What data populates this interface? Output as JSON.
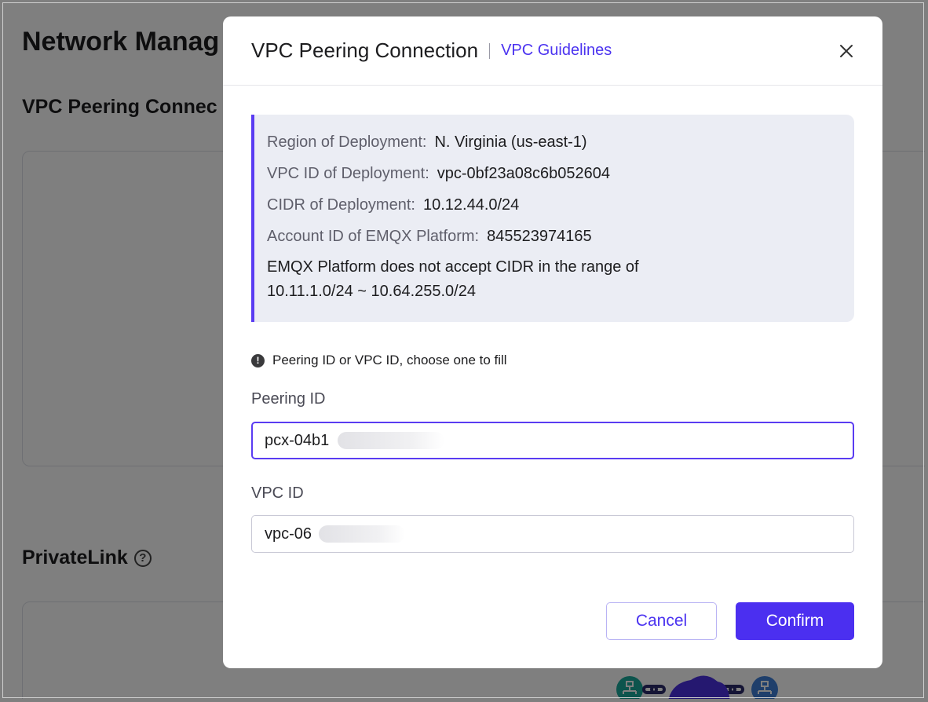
{
  "background": {
    "page_title": "Network Manag",
    "vpc_section_title": "VPC Peering Connec",
    "privatelink_title": "PrivateLink",
    "help_icon": "question-circle-icon"
  },
  "dialog": {
    "title": "VPC Peering Connection",
    "guide_link": "VPC Guidelines",
    "close_icon": "close-icon",
    "info": {
      "region_label": "Region of Deployment:",
      "region_value": "N. Virginia (us-east-1)",
      "vpc_id_label": "VPC ID of Deployment:",
      "vpc_id_value": "vpc-0bf23a08c6b052604",
      "cidr_label": "CIDR of Deployment:",
      "cidr_value": "10.12.44.0/24",
      "account_label": "Account ID of EMQX Platform:",
      "account_value": "845523974165",
      "note_line1": "EMQX Platform does not accept CIDR in the range of",
      "note_line2": "10.11.1.0/24 ~ 10.64.255.0/24"
    },
    "hint": "Peering ID or VPC ID, choose one to fill",
    "hint_icon": "exclamation-circle-icon",
    "peering_id": {
      "label": "Peering ID",
      "value": "pcx-04b1"
    },
    "vpc_id": {
      "label": "VPC ID",
      "value": "vpc-06"
    },
    "cancel_label": "Cancel",
    "confirm_label": "Confirm"
  },
  "colors": {
    "accent": "#4b2ff0",
    "link": "#4b33f0",
    "info_bg": "#ebedf4",
    "overlay": "rgba(0,0,0,0.5)"
  }
}
